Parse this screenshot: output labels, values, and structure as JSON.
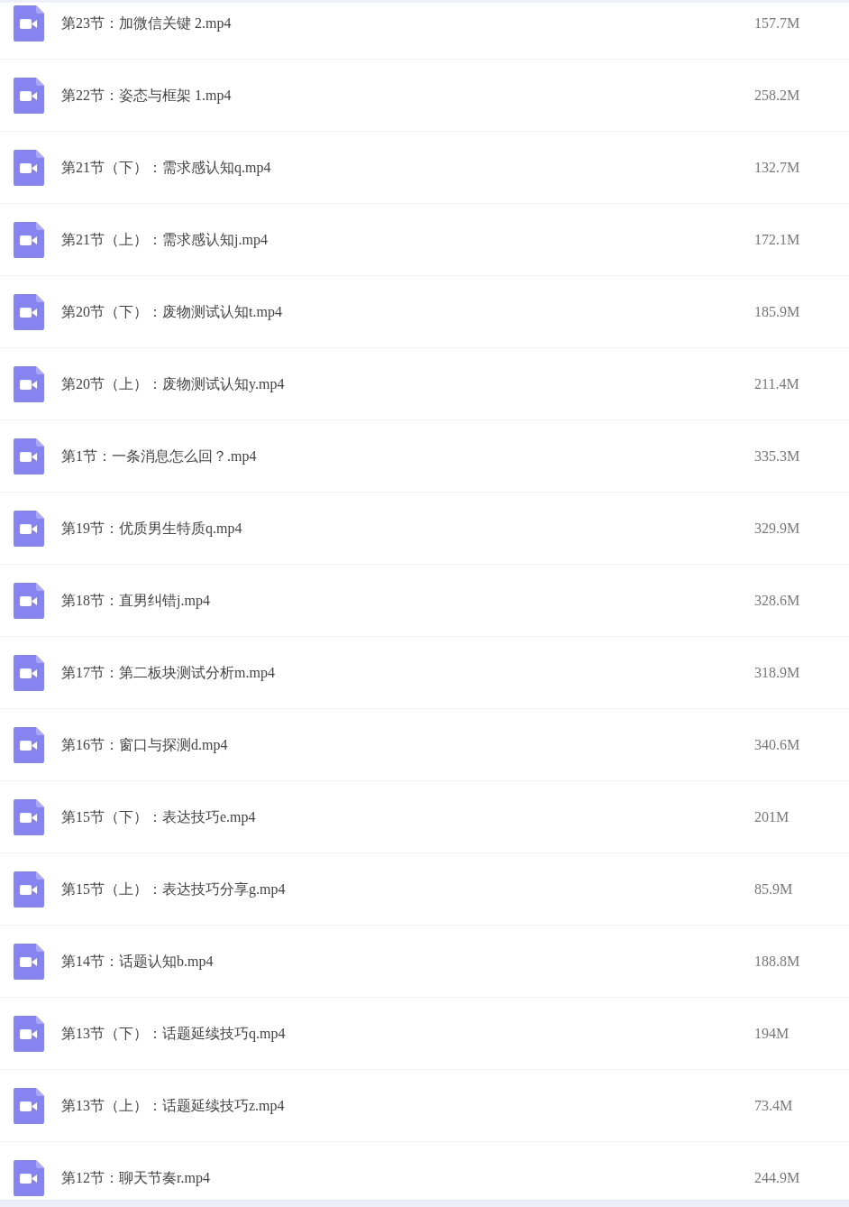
{
  "files": [
    {
      "name": "第23节：加微信关键 2.mp4",
      "size": "157.7M"
    },
    {
      "name": "第22节：姿态与框架 1.mp4",
      "size": "258.2M"
    },
    {
      "name": "第21节（下）：需求感认知q.mp4",
      "size": "132.7M"
    },
    {
      "name": "第21节（上）：需求感认知j.mp4",
      "size": "172.1M"
    },
    {
      "name": "第20节（下）：废物测试认知t.mp4",
      "size": "185.9M"
    },
    {
      "name": "第20节（上）：废物测试认知y.mp4",
      "size": "211.4M"
    },
    {
      "name": "第1节：一条消息怎么回？.mp4",
      "size": "335.3M"
    },
    {
      "name": "第19节：优质男生特质q.mp4",
      "size": "329.9M"
    },
    {
      "name": "第18节：直男纠错j.mp4",
      "size": "328.6M"
    },
    {
      "name": "第17节：第二板块测试分析m.mp4",
      "size": "318.9M"
    },
    {
      "name": "第16节：窗口与探测d.mp4",
      "size": "340.6M"
    },
    {
      "name": "第15节（下）：表达技巧e.mp4",
      "size": "201M"
    },
    {
      "name": "第15节（上）：表达技巧分享g.mp4",
      "size": "85.9M"
    },
    {
      "name": "第14节：话题认知b.mp4",
      "size": "188.8M"
    },
    {
      "name": "第13节（下）：话题延续技巧q.mp4",
      "size": "194M"
    },
    {
      "name": "第13节（上）：话题延续技巧z.mp4",
      "size": "73.4M"
    },
    {
      "name": "第12节：聊天节奏r.mp4",
      "size": "244.9M"
    }
  ]
}
